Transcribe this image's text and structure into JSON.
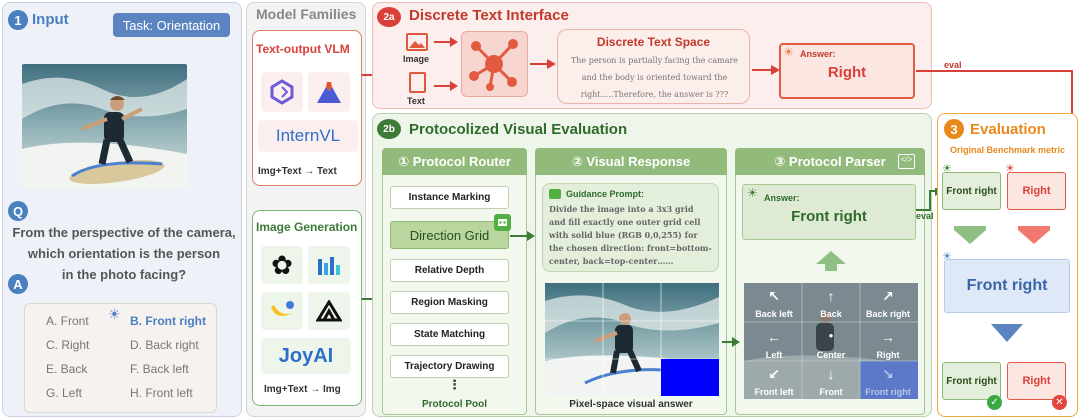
{
  "input": {
    "num": "1",
    "title": "Input",
    "task": "Task: Orientation",
    "q_badge": "Q",
    "question_lines": [
      "From the perspective of the camera,",
      "which orientation is the person",
      "in the photo facing?"
    ],
    "a_badge": "A",
    "options": [
      "A. Front",
      "B. Front right",
      "C. Right",
      "D. Back right",
      "E. Back",
      "F. Back left",
      "G. Left",
      "H. Front left"
    ]
  },
  "families": {
    "title": "Model Families",
    "vlm_title": "Text-output VLM",
    "internvl": "InternVL",
    "vlm_io": "Img+Text → Text",
    "gen_title": "Image Generation",
    "joyai": "JoyAI",
    "gen_io": "Img+Text → Img"
  },
  "discrete": {
    "num": "2a",
    "title": "Discrete Text Interface",
    "image_label": "Image",
    "text_label": "Text",
    "space_title": "Discrete Text Space",
    "space_lines": [
      "The person is partially facing the camare",
      "and the body is oriented toward the",
      "right.....Therefore, the answer is ???"
    ],
    "answer_label": "Answer:",
    "answer": "Right",
    "eval": "eval"
  },
  "protocol": {
    "num": "2b",
    "title": "Protocolized Visual Evaluation",
    "router_title": "① Protocol Router",
    "pool": [
      "Instance Marking",
      "Direction Grid",
      "Relative Depth",
      "Region Masking",
      "State Matching",
      "Trajectory Drawing"
    ],
    "dots": "⋮",
    "pool_label": "Protocol Pool",
    "response_title": "② Visual Response",
    "guidance_title": "Guidance Prompt:",
    "guidance_lines": [
      "Divide the image into a 3x3 grid",
      "and fill exactly one outer grid cell",
      "with solid blue (RGB 0,0,255) for",
      "the chosen direction: front=bottom-",
      "center, back=top-center……"
    ],
    "pixel_label": "Pixel-space visual answer",
    "parser_title": "③ Protocol Parser",
    "answer_label": "Answer:",
    "answer": "Front right",
    "eval": "eval",
    "grid": [
      "Back left",
      "Back",
      "Back right",
      "Left",
      "Center",
      "Right",
      "Front left",
      "Front",
      "Front right"
    ],
    "grid_arrows": [
      "↖",
      "↑",
      "↗",
      "←",
      "●",
      "→",
      "↙",
      "↓",
      "↘"
    ]
  },
  "evaluation": {
    "num": "3",
    "title": "Evaluation",
    "metric": "Original Benchmark metric",
    "top_left": "Front right",
    "top_right": "Right",
    "middle": "Front right",
    "bottom_left": "Front right",
    "bottom_right": "Right"
  },
  "colors": {
    "blue": "#4a7fc0",
    "red": "#d9403a",
    "green": "#3d7a38",
    "orange": "#e8891c"
  }
}
